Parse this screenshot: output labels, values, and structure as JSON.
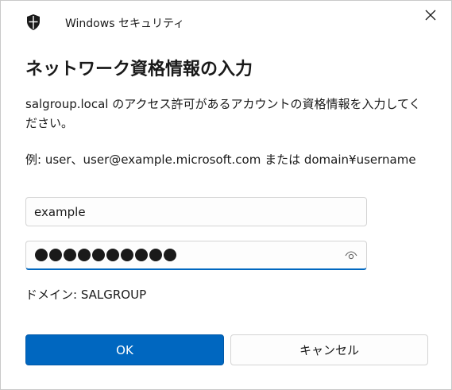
{
  "window": {
    "title": "Windows セキュリティ",
    "close_icon": "close-icon",
    "app_icon": "shield-icon"
  },
  "dialog": {
    "heading": "ネットワーク資格情報の入力",
    "description": "salgroup.local のアクセス許可があるアカウントの資格情報を入力してください。",
    "example": "例: user、user@example.microsoft.com または domain¥username",
    "domain_text": "ドメイン: SALGROUP"
  },
  "form": {
    "username_value": "example",
    "password_mask_count": 10,
    "reveal_icon": "eye-icon"
  },
  "buttons": {
    "ok_label": "OK",
    "cancel_label": "キャンセル"
  },
  "colors": {
    "accent": "#0067c0",
    "border": "#d4d4d4"
  }
}
